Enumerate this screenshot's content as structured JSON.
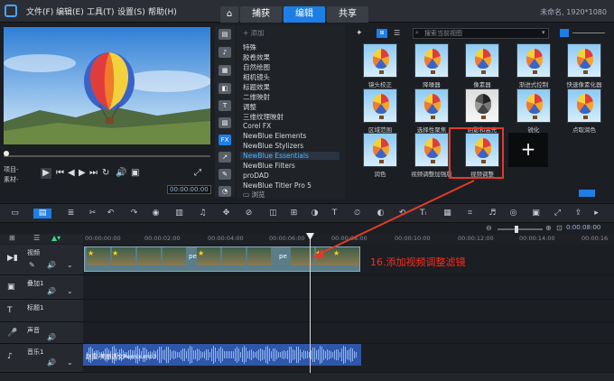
{
  "menubar": {
    "file": "文件(F)",
    "edit": "编辑(E)",
    "tools": "工具(T)",
    "settings": "设置(S)",
    "help": "帮助(H)",
    "resolution": "未命名, 1920*1080"
  },
  "tabs": {
    "capture": "捕获",
    "edit": "编辑",
    "share": "共享"
  },
  "player": {
    "project_label": "项目-",
    "clip_label": "素材-",
    "timecode": "00:00:00:00"
  },
  "library": {
    "add_label": "添加",
    "search_placeholder": "搜索当前视图",
    "browse_label": "浏览",
    "categories": [
      "特殊",
      "胶卷效果",
      "自然绘图",
      "相机镜头",
      "标题效果",
      "二维映射",
      "调整",
      "三维纹理映射",
      "Corel FX",
      "NewBlue Elements",
      "NewBlue Stylizers",
      "NewBlue Essentials",
      "NewBlue Filters",
      "proDAD",
      "NewBlue Titler Pro 5"
    ],
    "selected_category": "NewBlue Essentials",
    "effects": [
      "镜头校正",
      "降噪器",
      "像素器",
      "渐进式控制",
      "快速像素化器",
      "区域范围",
      "选择性聚焦",
      "阴影和高光",
      "锐化",
      "点取润色",
      "润色",
      "视频调整加强版",
      "视频调整"
    ],
    "selected_effect": "视频调整"
  },
  "timeline": {
    "ruler": [
      "00:00:00:00",
      "00:00:02:00",
      "00:00:04:00",
      "00:00:06:00",
      "00:00:08:00",
      "00:00:10:00",
      "00:00:12:00",
      "00:00:14:00",
      "00:00:16"
    ],
    "duration": "0:00:08:00",
    "tracks": {
      "video": "视频",
      "overlay": "叠加1",
      "title": "标题1",
      "voice": "声音",
      "music": "音乐1"
    },
    "audio_clip": "赵雷-美丽遇文Remix.mp3",
    "clip_label": "pe"
  },
  "annotation": "16.添加视频调整滤镜",
  "colors": {
    "accent": "#1e7ee6",
    "highlight": "#e23a2a",
    "audio": "#2f56a8"
  }
}
